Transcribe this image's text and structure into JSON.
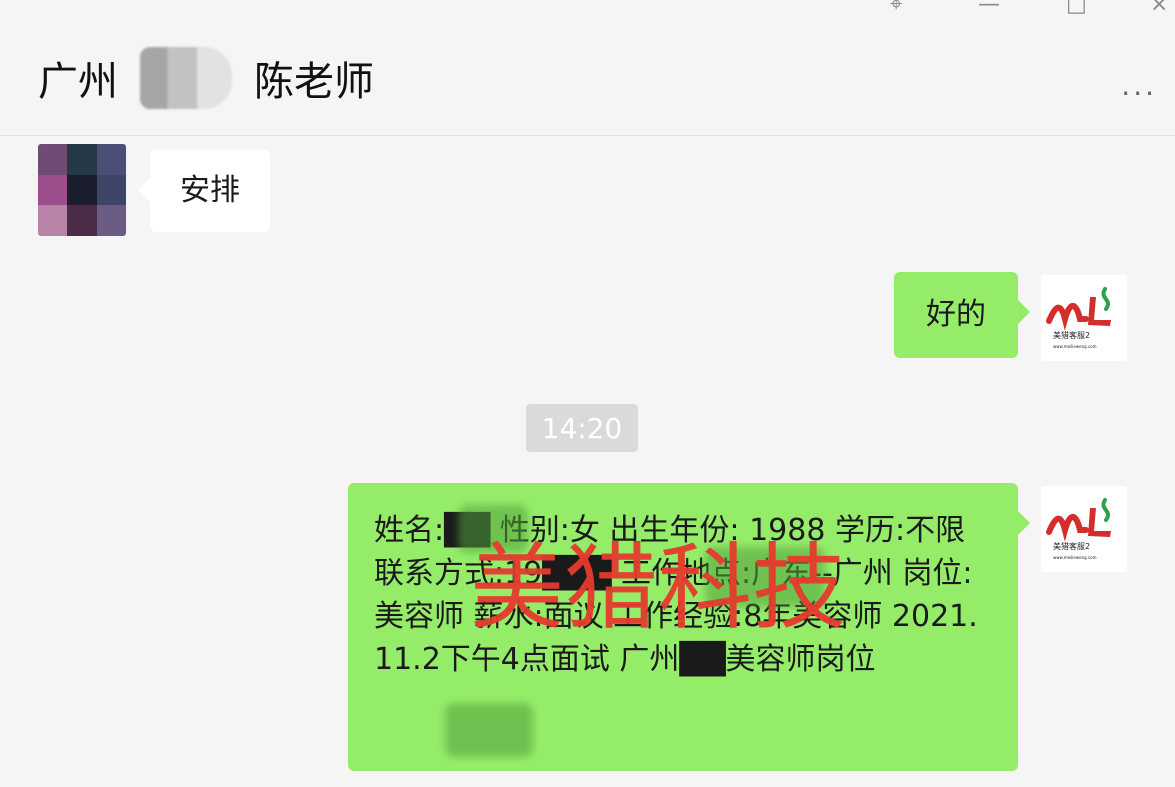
{
  "window": {
    "controls": {
      "pin_icon": "pin-icon",
      "minimize_icon": "minimize-icon",
      "maximize_icon": "maximize-icon",
      "close_icon": "close-icon"
    }
  },
  "chat": {
    "title_prefix": "广州",
    "title_suffix": "陈老师",
    "more_label": "..."
  },
  "messages": {
    "left_1": "安排",
    "right_1": "好的",
    "time": "14:20",
    "right_2": "姓名:██ 性别:女 出生年份: 1988 学历:不限 联系方式:19███ 工作地点:广东--广州 岗位:美容师 薪水:面议 工作经验:8年美容师 2021.11.2下午4点面试 广州██美容师岗位"
  },
  "watermark": {
    "text": "美猎科技"
  },
  "avatar": {
    "brand_text": "美猎客服2",
    "small_text": "www.meilieweng.com"
  },
  "colors": {
    "sent_bubble": "#95ec69",
    "received_bubble": "#ffffff",
    "watermark": "#e53b2e"
  }
}
